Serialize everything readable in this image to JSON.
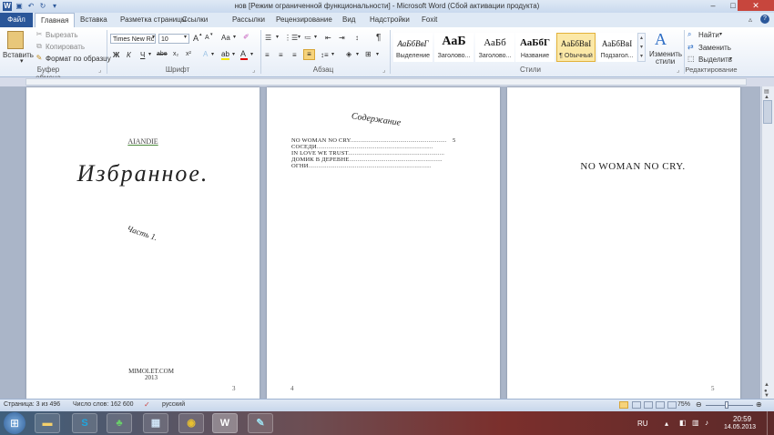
{
  "window": {
    "title": "нов [Режим ограниченной функциональности]  -  Microsoft Word (Сбой активации продукта)",
    "btn_min": "–",
    "btn_max": "□",
    "btn_close": "✕"
  },
  "tabs": {
    "file": "Файл",
    "items": [
      "Главная",
      "Вставка",
      "Разметка страницы",
      "Ссылки",
      "Рассылки",
      "Рецензирование",
      "Вид",
      "Надстройки",
      "Foxit"
    ]
  },
  "clipboard": {
    "paste": "Вставить",
    "cut": "Вырезать",
    "copy": "Копировать",
    "format_painter": "Формат по образцу",
    "label": "Буфер обмена"
  },
  "font": {
    "name": "Times New Rc",
    "size": "10",
    "bold": "Ж",
    "italic": "К",
    "underline": "Ч",
    "strike": "abe",
    "subscript": "x₂",
    "superscript": "x²",
    "grow": "A",
    "shrink": "A",
    "case": "Aa",
    "label": "Шрифт"
  },
  "paragraph": {
    "label": "Абзац",
    "pilcrow": "¶"
  },
  "styles": {
    "label": "Стили",
    "items": [
      {
        "sample": "АаБбВвГ",
        "name": "Выделение"
      },
      {
        "sample": "АаБ",
        "name": "Заголово..."
      },
      {
        "sample": "АаБб",
        "name": "Заголово..."
      },
      {
        "sample": "АаБбГ",
        "name": "Название"
      },
      {
        "sample": "АаБбВвI",
        "name": "¶ Обычный"
      },
      {
        "sample": "АаБбВвI",
        "name": "Подзагол..."
      }
    ],
    "change_styles_1": "Изменить",
    "change_styles_2": "стили"
  },
  "editing": {
    "label": "Редактирование",
    "find": "Найти",
    "replace": "Заменить",
    "select": "Выделить"
  },
  "pages": [
    {
      "author": "AIANDIE",
      "title": "Избранное.",
      "part": "Часть 1.",
      "footer_site": "MIMOLET.COM",
      "footer_year": "2013",
      "number": "3"
    },
    {
      "heading": "Содержание",
      "toc": [
        {
          "text": "NO WOMAN NO CRY",
          "dots": "..........................................................",
          "page": "5"
        },
        {
          "text": "СОСЕДИ",
          "dots": "......................................................................",
          "page": ""
        },
        {
          "text": "IN LOVE WE TRUST",
          "dots": "..........................................................",
          "page": ""
        },
        {
          "text": "ДОМИК В ДЕРЕВНЕ",
          "dots": "........................................................",
          "page": ""
        },
        {
          "text": "ОГНИ",
          "dots": "..........................................................................",
          "page": ""
        }
      ],
      "number": "4"
    },
    {
      "heading": "NO WOMAN NO CRY.",
      "number": "5"
    }
  ],
  "status": {
    "page": "Страница: 3 из 496",
    "words": "Число слов: 162 600",
    "language": "русский",
    "zoom": "75%"
  },
  "taskbar": {
    "lang": "RU",
    "time": "20:59",
    "date": "14.05.2013"
  },
  "colors": {
    "file_tab": "#2a5699",
    "accent": "#2b579a",
    "close": "#c7463d"
  }
}
